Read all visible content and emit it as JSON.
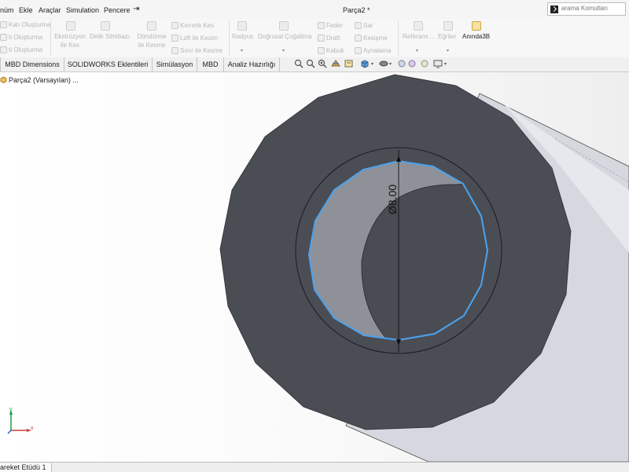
{
  "menu": {
    "items": [
      "nüm",
      "Ekle",
      "Araçlar",
      "Simulation",
      "Pencere"
    ],
    "pin_icon": "pin-icon"
  },
  "document": {
    "title": "Parça2 *"
  },
  "search": {
    "placeholder": "arama Komutları"
  },
  "ribbon": {
    "col1": [
      "Katı Oluşturma",
      "ti Oluşturma",
      "ti Oluşturma"
    ],
    "extrude_cut": [
      "Ekstrüzyon",
      "ile Kes"
    ],
    "hole_wizard": "Delik Sihirbazı",
    "revolve_cut": [
      "Döndürme",
      "ile Kesme"
    ],
    "col_cut": [
      "Kıvrımlı Kes",
      "Loft ile Kesim",
      "Sınır ile Kesme"
    ],
    "fillet": "Radyus",
    "linear_pattern": "Doğrusal Çoğaltma",
    "col_features": [
      "Feder",
      "Draft",
      "Kabuk"
    ],
    "col_features2": [
      "Sar",
      "Kesişme",
      "Aynalama"
    ],
    "reference": "Referans ...",
    "curves": "Eğriler",
    "instant3d": "Anında3B"
  },
  "tabs": [
    "MBD Dimensions",
    "SOLIDWORKS Eklentileri",
    "Simülasyon",
    "MBD",
    "Analiz Hazırlığı"
  ],
  "tree": {
    "root": "Parça2 (Varsayılan) ..."
  },
  "dimension": {
    "label": "Ø8.00"
  },
  "bottom": {
    "motion_tab": "areket Etüdü 1"
  },
  "colors": {
    "part_face": "#4a4c54",
    "selection_edge": "#4aa3ef",
    "cylinder_body": "#d7d9e0",
    "bore": "#8e9099"
  },
  "icons": [
    "search-icon",
    "pin-icon",
    "zoom-fit-icon",
    "zoom-area-icon",
    "previous-view-icon",
    "section-view-icon",
    "view-orientation-icon",
    "display-style-icon",
    "hide-show-icon",
    "appearance-icon",
    "scene-icon",
    "display-settings-icon",
    "triad-icon",
    "part-icon"
  ]
}
